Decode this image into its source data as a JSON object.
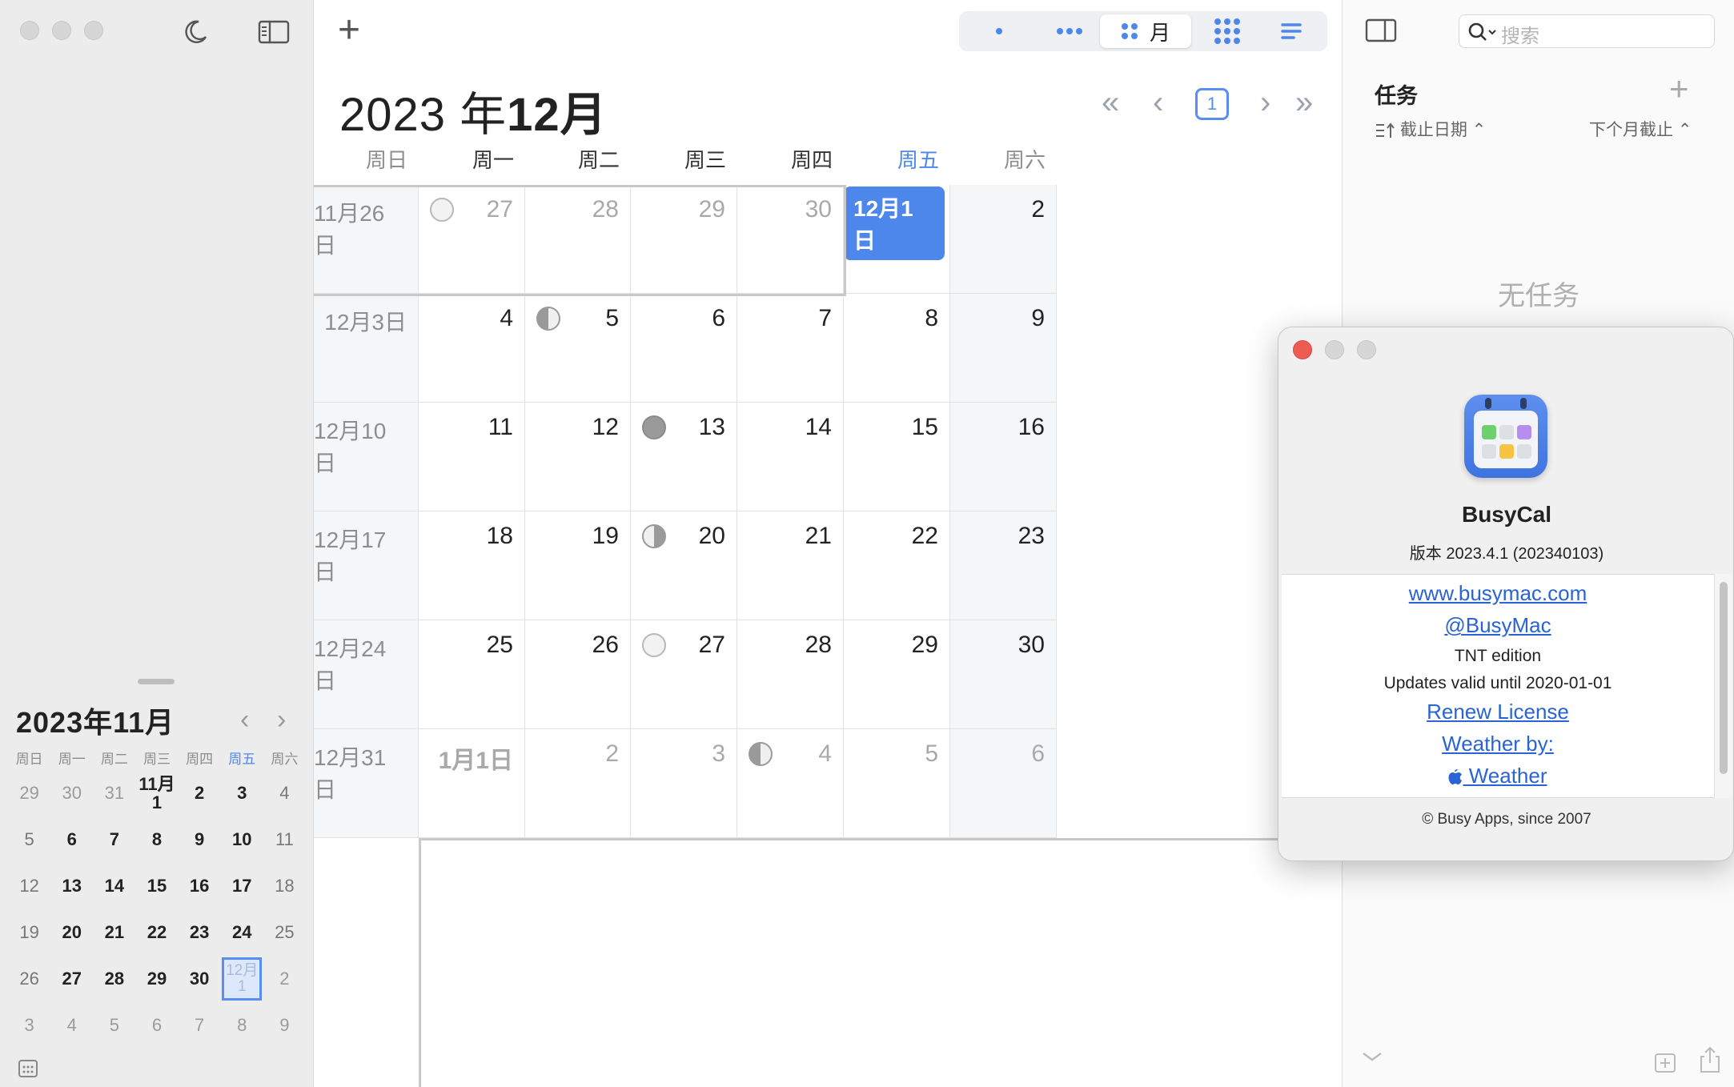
{
  "sidebar": {
    "mini_calendar": {
      "title": "2023年11月",
      "prev": "‹",
      "next": "›",
      "weekdays": [
        "周日",
        "周一",
        "周二",
        "周三",
        "周四",
        "周五",
        "周六"
      ],
      "days": [
        {
          "t": "29",
          "k": "dim"
        },
        {
          "t": "30",
          "k": "dim"
        },
        {
          "t": "31",
          "k": "dim"
        },
        {
          "t": "11月\n1",
          "k": ""
        },
        {
          "t": "2",
          "k": ""
        },
        {
          "t": "3",
          "k": ""
        },
        {
          "t": "4",
          "k": "we"
        },
        {
          "t": "5",
          "k": "we"
        },
        {
          "t": "6",
          "k": ""
        },
        {
          "t": "7",
          "k": ""
        },
        {
          "t": "8",
          "k": ""
        },
        {
          "t": "9",
          "k": ""
        },
        {
          "t": "10",
          "k": ""
        },
        {
          "t": "11",
          "k": "we"
        },
        {
          "t": "12",
          "k": "we"
        },
        {
          "t": "13",
          "k": ""
        },
        {
          "t": "14",
          "k": ""
        },
        {
          "t": "15",
          "k": ""
        },
        {
          "t": "16",
          "k": ""
        },
        {
          "t": "17",
          "k": ""
        },
        {
          "t": "18",
          "k": "we"
        },
        {
          "t": "19",
          "k": "we"
        },
        {
          "t": "20",
          "k": ""
        },
        {
          "t": "21",
          "k": ""
        },
        {
          "t": "22",
          "k": ""
        },
        {
          "t": "23",
          "k": ""
        },
        {
          "t": "24",
          "k": ""
        },
        {
          "t": "25",
          "k": "we"
        },
        {
          "t": "26",
          "k": "we"
        },
        {
          "t": "27",
          "k": ""
        },
        {
          "t": "28",
          "k": ""
        },
        {
          "t": "29",
          "k": ""
        },
        {
          "t": "30",
          "k": ""
        },
        {
          "t": "12月\n1",
          "k": "today"
        },
        {
          "t": "2",
          "k": "dim"
        },
        {
          "t": "3",
          "k": "dim"
        },
        {
          "t": "4",
          "k": "dim"
        },
        {
          "t": "5",
          "k": "dim"
        },
        {
          "t": "6",
          "k": "dim"
        },
        {
          "t": "7",
          "k": "dim"
        },
        {
          "t": "8",
          "k": "dim"
        },
        {
          "t": "9",
          "k": "dim"
        }
      ]
    }
  },
  "toolbar": {
    "add_label": "+",
    "month_view_label": "月"
  },
  "header": {
    "year_label": "2023 年",
    "month_label": "12月",
    "today_button": "1",
    "nav": {
      "first": "«",
      "prev": "‹",
      "next": "›",
      "last": "»"
    }
  },
  "calendar": {
    "weekday_headers": [
      "周日",
      "周一",
      "周二",
      "周三",
      "周四",
      "周五",
      "周六"
    ],
    "weeks": [
      [
        {
          "t": "11月26日",
          "k": "sun dim"
        },
        {
          "t": "27",
          "k": "dim",
          "moon": "full"
        },
        {
          "t": "28",
          "k": "dim"
        },
        {
          "t": "29",
          "k": "dim"
        },
        {
          "t": "30",
          "k": "dim"
        },
        {
          "t": "12月1日",
          "k": "today"
        },
        {
          "t": "2",
          "k": "sat"
        }
      ],
      [
        {
          "t": "12月3日",
          "k": "sun"
        },
        {
          "t": "4",
          "k": ""
        },
        {
          "t": "5",
          "k": "",
          "moon": "lastq"
        },
        {
          "t": "6",
          "k": ""
        },
        {
          "t": "7",
          "k": ""
        },
        {
          "t": "8",
          "k": ""
        },
        {
          "t": "9",
          "k": "sat"
        }
      ],
      [
        {
          "t": "12月10日",
          "k": "sun"
        },
        {
          "t": "11",
          "k": ""
        },
        {
          "t": "12",
          "k": ""
        },
        {
          "t": "13",
          "k": "",
          "moon": "new"
        },
        {
          "t": "14",
          "k": ""
        },
        {
          "t": "15",
          "k": ""
        },
        {
          "t": "16",
          "k": "sat"
        }
      ],
      [
        {
          "t": "12月17日",
          "k": "sun"
        },
        {
          "t": "18",
          "k": ""
        },
        {
          "t": "19",
          "k": ""
        },
        {
          "t": "20",
          "k": "",
          "moon": "firstq"
        },
        {
          "t": "21",
          "k": ""
        },
        {
          "t": "22",
          "k": ""
        },
        {
          "t": "23",
          "k": "sat"
        }
      ],
      [
        {
          "t": "12月24日",
          "k": "sun"
        },
        {
          "t": "25",
          "k": ""
        },
        {
          "t": "26",
          "k": ""
        },
        {
          "t": "27",
          "k": "",
          "moon": "full"
        },
        {
          "t": "28",
          "k": ""
        },
        {
          "t": "29",
          "k": ""
        },
        {
          "t": "30",
          "k": "sat"
        }
      ],
      [
        {
          "t": "12月31日",
          "k": "sun"
        },
        {
          "t": "1月1日",
          "k": "dim bold"
        },
        {
          "t": "2",
          "k": "dim"
        },
        {
          "t": "3",
          "k": "dim"
        },
        {
          "t": "4",
          "k": "dim",
          "moon": "lastq"
        },
        {
          "t": "5",
          "k": "dim"
        },
        {
          "t": "6",
          "k": "dim sat"
        }
      ]
    ]
  },
  "tasks_panel": {
    "search_placeholder": "搜索",
    "title": "任务",
    "add": "+",
    "sort_by": "截止日期 ⌃",
    "filter": "下个月截止 ⌃",
    "empty": "无任务"
  },
  "about_dialog": {
    "app_name": "BusyCal",
    "version": "版本 2023.4.1 (202340103)",
    "website": "www.busymac.com",
    "twitter": "@BusyMac",
    "edition": "TNT edition",
    "updates": "Updates valid until 2020-01-01",
    "renew": "Renew License",
    "weather_by": "Weather by:",
    "weather": " Weather",
    "copyright": "© Busy Apps, since 2007"
  },
  "colors": {
    "accent": "#4d87ec",
    "today_text": "#5a8df0",
    "link": "#2a63d4"
  }
}
